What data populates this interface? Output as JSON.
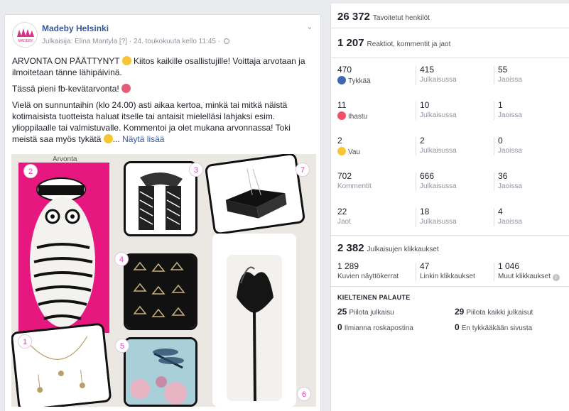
{
  "post": {
    "page_name": "Madeby Helsinki",
    "avatar_text": "MADEBY",
    "meta": "Julkaisija: Elina Mantyla [?] · 24. toukokuuta kello 11:45 ·",
    "para1_a": "ARVONTA ON PÄÄTTYNYT",
    "para1_b": " Kiitos kaikille osallistujille! Voittaja arvotaan ja ilmoitetaan tänne lähipäivinä.",
    "para2": "Tässä pieni fb-kevätarvonta!",
    "para3": "Vielä on sunnuntaihin (klo 24.00) asti aikaa kertoa, minkä tai mitkä näistä kotimaisista tuotteista haluat itselle tai antaisit mielelläsi lahjaksi esim. ylioppilaalle tai valmistuvalle. Kommentoi ja olet mukana arvonnassa! Toki meistä saa myös tykätä",
    "ellipsis": "...",
    "see_more": "Näytä lisää",
    "collage_label": "Arvonta",
    "numbers": [
      "1",
      "2",
      "3",
      "4",
      "5",
      "6",
      "7"
    ]
  },
  "insights": {
    "reached": {
      "value": "26 372",
      "label": "Tavoitetut henkilöt"
    },
    "engagement": {
      "value": "1 207",
      "label": "Reaktiot, kommentit ja jaot"
    },
    "rows": [
      {
        "icon": "like-icon",
        "total": "470",
        "label": "Tykkää",
        "on_post": "415",
        "on_post_label": "Julkaisussa",
        "shares": "55",
        "shares_label": "Jaoissa"
      },
      {
        "icon": "love-icon",
        "total": "11",
        "label": "Ihastu",
        "on_post": "10",
        "on_post_label": "Julkaisussa",
        "shares": "1",
        "shares_label": "Jaoissa"
      },
      {
        "icon": "wow-icon",
        "total": "2",
        "label": "Vau",
        "on_post": "2",
        "on_post_label": "Julkaisussa",
        "shares": "0",
        "shares_label": "Jaoissa"
      },
      {
        "icon": "",
        "total": "702",
        "label": "Kommentit",
        "on_post": "666",
        "on_post_label": "Julkaisussa",
        "shares": "36",
        "shares_label": "Jaoissa"
      },
      {
        "icon": "",
        "total": "22",
        "label": "Jaot",
        "on_post": "18",
        "on_post_label": "Julkaisussa",
        "shares": "4",
        "shares_label": "Jaoissa"
      }
    ],
    "clicks": {
      "value": "2 382",
      "label": "Julkaisujen klikkaukset"
    },
    "click_breakdown": [
      {
        "value": "1 289",
        "label": "Kuvien näyttökerrat"
      },
      {
        "value": "47",
        "label": "Linkin klikkaukset"
      },
      {
        "value": "1 046",
        "label": "Muut klikkaukset"
      }
    ],
    "negative_title": "KIELTEINEN PALAUTE",
    "negative": [
      {
        "value": "25",
        "label": "Piilota julkaisu"
      },
      {
        "value": "29",
        "label": "Piilota kaikki julkaisut"
      },
      {
        "value": "0",
        "label": "Ilmianna roskapostina"
      },
      {
        "value": "0",
        "label": "En tykkääkään sivusta"
      }
    ]
  },
  "colors": {
    "link": "#365899",
    "accent_pink": "#e6177f"
  }
}
